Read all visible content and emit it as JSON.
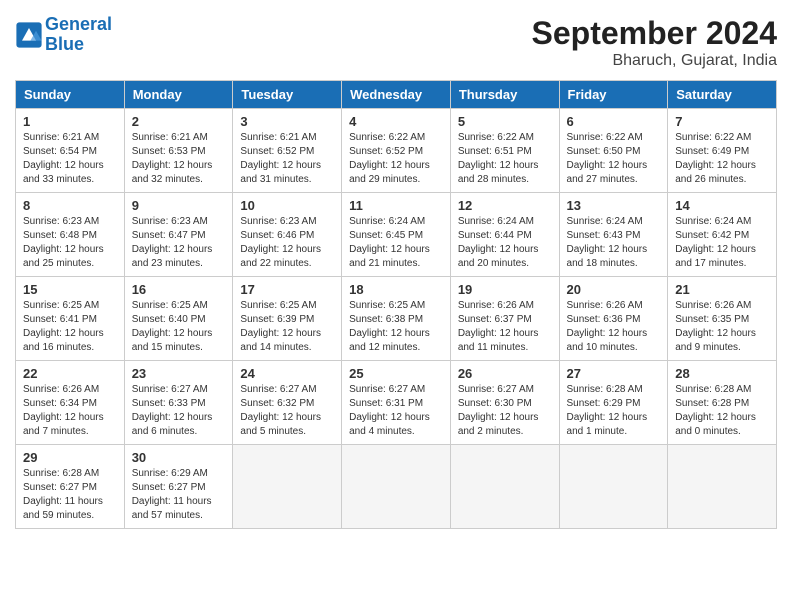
{
  "header": {
    "logo_line1": "General",
    "logo_line2": "Blue",
    "month_title": "September 2024",
    "subtitle": "Bharuch, Gujarat, India"
  },
  "weekdays": [
    "Sunday",
    "Monday",
    "Tuesday",
    "Wednesday",
    "Thursday",
    "Friday",
    "Saturday"
  ],
  "weeks": [
    [
      {
        "day": "1",
        "sunrise": "6:21 AM",
        "sunset": "6:54 PM",
        "daylight": "12 hours and 33 minutes."
      },
      {
        "day": "2",
        "sunrise": "6:21 AM",
        "sunset": "6:53 PM",
        "daylight": "12 hours and 32 minutes."
      },
      {
        "day": "3",
        "sunrise": "6:21 AM",
        "sunset": "6:52 PM",
        "daylight": "12 hours and 31 minutes."
      },
      {
        "day": "4",
        "sunrise": "6:22 AM",
        "sunset": "6:52 PM",
        "daylight": "12 hours and 29 minutes."
      },
      {
        "day": "5",
        "sunrise": "6:22 AM",
        "sunset": "6:51 PM",
        "daylight": "12 hours and 28 minutes."
      },
      {
        "day": "6",
        "sunrise": "6:22 AM",
        "sunset": "6:50 PM",
        "daylight": "12 hours and 27 minutes."
      },
      {
        "day": "7",
        "sunrise": "6:22 AM",
        "sunset": "6:49 PM",
        "daylight": "12 hours and 26 minutes."
      }
    ],
    [
      {
        "day": "8",
        "sunrise": "6:23 AM",
        "sunset": "6:48 PM",
        "daylight": "12 hours and 25 minutes."
      },
      {
        "day": "9",
        "sunrise": "6:23 AM",
        "sunset": "6:47 PM",
        "daylight": "12 hours and 23 minutes."
      },
      {
        "day": "10",
        "sunrise": "6:23 AM",
        "sunset": "6:46 PM",
        "daylight": "12 hours and 22 minutes."
      },
      {
        "day": "11",
        "sunrise": "6:24 AM",
        "sunset": "6:45 PM",
        "daylight": "12 hours and 21 minutes."
      },
      {
        "day": "12",
        "sunrise": "6:24 AM",
        "sunset": "6:44 PM",
        "daylight": "12 hours and 20 minutes."
      },
      {
        "day": "13",
        "sunrise": "6:24 AM",
        "sunset": "6:43 PM",
        "daylight": "12 hours and 18 minutes."
      },
      {
        "day": "14",
        "sunrise": "6:24 AM",
        "sunset": "6:42 PM",
        "daylight": "12 hours and 17 minutes."
      }
    ],
    [
      {
        "day": "15",
        "sunrise": "6:25 AM",
        "sunset": "6:41 PM",
        "daylight": "12 hours and 16 minutes."
      },
      {
        "day": "16",
        "sunrise": "6:25 AM",
        "sunset": "6:40 PM",
        "daylight": "12 hours and 15 minutes."
      },
      {
        "day": "17",
        "sunrise": "6:25 AM",
        "sunset": "6:39 PM",
        "daylight": "12 hours and 14 minutes."
      },
      {
        "day": "18",
        "sunrise": "6:25 AM",
        "sunset": "6:38 PM",
        "daylight": "12 hours and 12 minutes."
      },
      {
        "day": "19",
        "sunrise": "6:26 AM",
        "sunset": "6:37 PM",
        "daylight": "12 hours and 11 minutes."
      },
      {
        "day": "20",
        "sunrise": "6:26 AM",
        "sunset": "6:36 PM",
        "daylight": "12 hours and 10 minutes."
      },
      {
        "day": "21",
        "sunrise": "6:26 AM",
        "sunset": "6:35 PM",
        "daylight": "12 hours and 9 minutes."
      }
    ],
    [
      {
        "day": "22",
        "sunrise": "6:26 AM",
        "sunset": "6:34 PM",
        "daylight": "12 hours and 7 minutes."
      },
      {
        "day": "23",
        "sunrise": "6:27 AM",
        "sunset": "6:33 PM",
        "daylight": "12 hours and 6 minutes."
      },
      {
        "day": "24",
        "sunrise": "6:27 AM",
        "sunset": "6:32 PM",
        "daylight": "12 hours and 5 minutes."
      },
      {
        "day": "25",
        "sunrise": "6:27 AM",
        "sunset": "6:31 PM",
        "daylight": "12 hours and 4 minutes."
      },
      {
        "day": "26",
        "sunrise": "6:27 AM",
        "sunset": "6:30 PM",
        "daylight": "12 hours and 2 minutes."
      },
      {
        "day": "27",
        "sunrise": "6:28 AM",
        "sunset": "6:29 PM",
        "daylight": "12 hours and 1 minute."
      },
      {
        "day": "28",
        "sunrise": "6:28 AM",
        "sunset": "6:28 PM",
        "daylight": "12 hours and 0 minutes."
      }
    ],
    [
      {
        "day": "29",
        "sunrise": "6:28 AM",
        "sunset": "6:27 PM",
        "daylight": "11 hours and 59 minutes."
      },
      {
        "day": "30",
        "sunrise": "6:29 AM",
        "sunset": "6:27 PM",
        "daylight": "11 hours and 57 minutes."
      },
      null,
      null,
      null,
      null,
      null
    ]
  ]
}
